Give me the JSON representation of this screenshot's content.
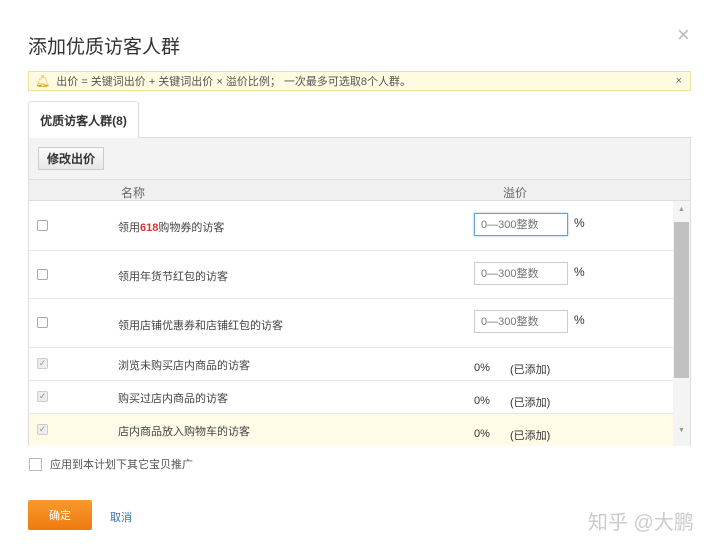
{
  "dialog": {
    "title": "添加优质访客人群",
    "close": "×"
  },
  "notice": {
    "text": "出价 = 关键词出价 + 关键词出价 × 溢价比例； 一次最多可选取8个人群。",
    "close": "×"
  },
  "tab": {
    "label": "优质访客人群(8)"
  },
  "toolbar": {
    "edit_label": "修改出价"
  },
  "table": {
    "headers": [
      "名称",
      "溢价"
    ],
    "rows": [
      {
        "prefix": "领用",
        "highlight": "618",
        "suffix": "购物券的访客",
        "placeholder": "0—300整数",
        "unit": "%"
      },
      {
        "name": "领用年货节红包的访客",
        "placeholder": "0—300整数",
        "unit": "%"
      },
      {
        "name": "领用店铺优惠券和店铺红包的访客",
        "placeholder": "0—300整数",
        "unit": "%"
      },
      {
        "name": "浏览未购买店内商品的访客",
        "value": "0%",
        "status": "(已添加)"
      },
      {
        "name": "购买过店内商品的访客",
        "value": "0%",
        "status": "(已添加)"
      },
      {
        "name": "店内商品放入购物车的访客",
        "value": "0%",
        "status": "(已添加)"
      }
    ]
  },
  "apply": {
    "label": "应用到本计划下其它宝贝推广"
  },
  "footer": {
    "ok": "确定",
    "cancel": "取消"
  },
  "watermark": "知乎 @大鹏"
}
